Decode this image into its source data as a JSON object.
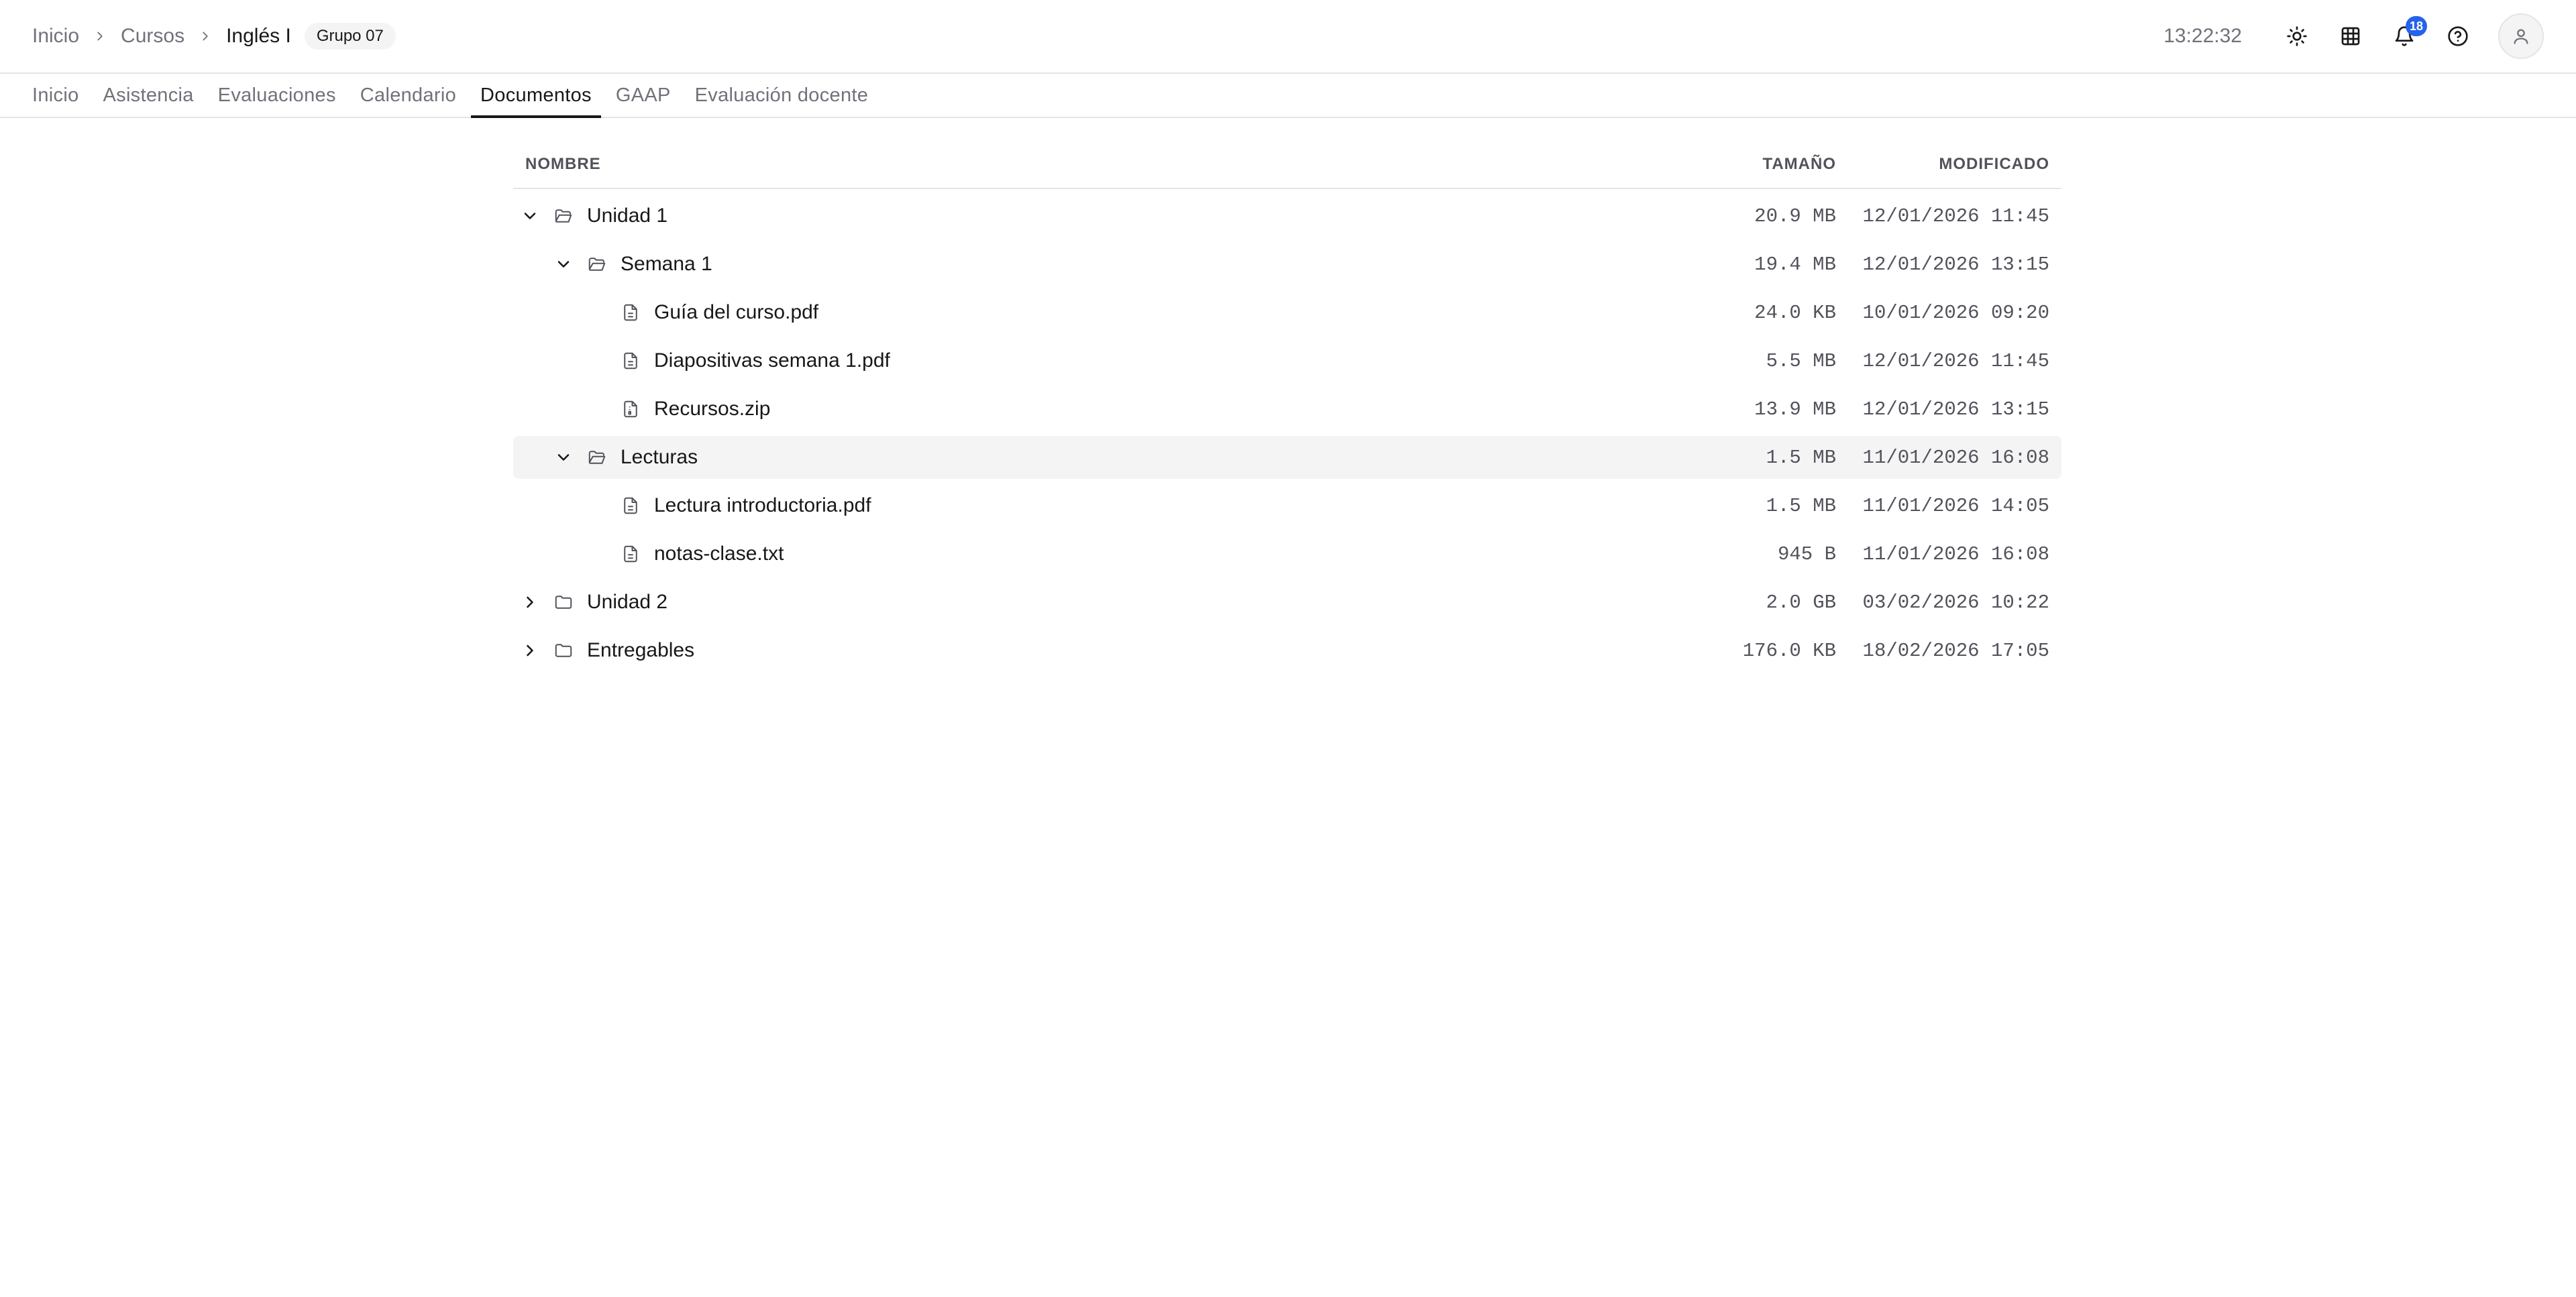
{
  "breadcrumb": {
    "items": [
      "Inicio",
      "Cursos"
    ],
    "current": "Inglés I",
    "group_badge": "Grupo 07"
  },
  "header": {
    "clock": "13:22:32",
    "notifications_count": "18"
  },
  "tabs": [
    {
      "label": "Inicio",
      "active": false
    },
    {
      "label": "Asistencia",
      "active": false
    },
    {
      "label": "Evaluaciones",
      "active": false
    },
    {
      "label": "Calendario",
      "active": false
    },
    {
      "label": "Documentos",
      "active": true
    },
    {
      "label": "GAAP",
      "active": false
    },
    {
      "label": "Evaluación docente",
      "active": false
    }
  ],
  "table": {
    "headers": {
      "name": "NOMBRE",
      "size": "TAMAÑO",
      "modified": "MODIFICADO"
    },
    "rows": [
      {
        "name": "Unidad 1",
        "type": "folder-open",
        "depth": 0,
        "expanded": true,
        "size": "20.9 MB",
        "modified": "12/01/2026 11:45",
        "highlighted": false
      },
      {
        "name": "Semana 1",
        "type": "folder-open",
        "depth": 1,
        "expanded": true,
        "size": "19.4 MB",
        "modified": "12/01/2026 13:15",
        "highlighted": false
      },
      {
        "name": "Guía del curso.pdf",
        "type": "file",
        "depth": 2,
        "size": "24.0 KB",
        "modified": "10/01/2026 09:20",
        "highlighted": false
      },
      {
        "name": "Diapositivas semana 1.pdf",
        "type": "file",
        "depth": 2,
        "size": "5.5 MB",
        "modified": "12/01/2026 11:45",
        "highlighted": false
      },
      {
        "name": "Recursos.zip",
        "type": "archive",
        "depth": 2,
        "size": "13.9 MB",
        "modified": "12/01/2026 13:15",
        "highlighted": false
      },
      {
        "name": "Lecturas",
        "type": "folder-open",
        "depth": 1,
        "expanded": true,
        "size": "1.5 MB",
        "modified": "11/01/2026 16:08",
        "highlighted": true
      },
      {
        "name": "Lectura introductoria.pdf",
        "type": "file",
        "depth": 2,
        "size": "1.5 MB",
        "modified": "11/01/2026 14:05",
        "highlighted": false
      },
      {
        "name": "notas-clase.txt",
        "type": "file",
        "depth": 2,
        "size": "945 B",
        "modified": "11/01/2026 16:08",
        "highlighted": false
      },
      {
        "name": "Unidad 2",
        "type": "folder",
        "depth": 0,
        "expanded": false,
        "size": "2.0 GB",
        "modified": "03/02/2026 10:22",
        "highlighted": false
      },
      {
        "name": "Entregables",
        "type": "folder",
        "depth": 0,
        "expanded": false,
        "size": "176.0 KB",
        "modified": "18/02/2026 17:05",
        "highlighted": false
      }
    ]
  },
  "colors": {
    "accent": "#2563eb",
    "active_tab": "#18181b",
    "muted": "#71717a",
    "row_highlight": "#f4f4f5"
  }
}
